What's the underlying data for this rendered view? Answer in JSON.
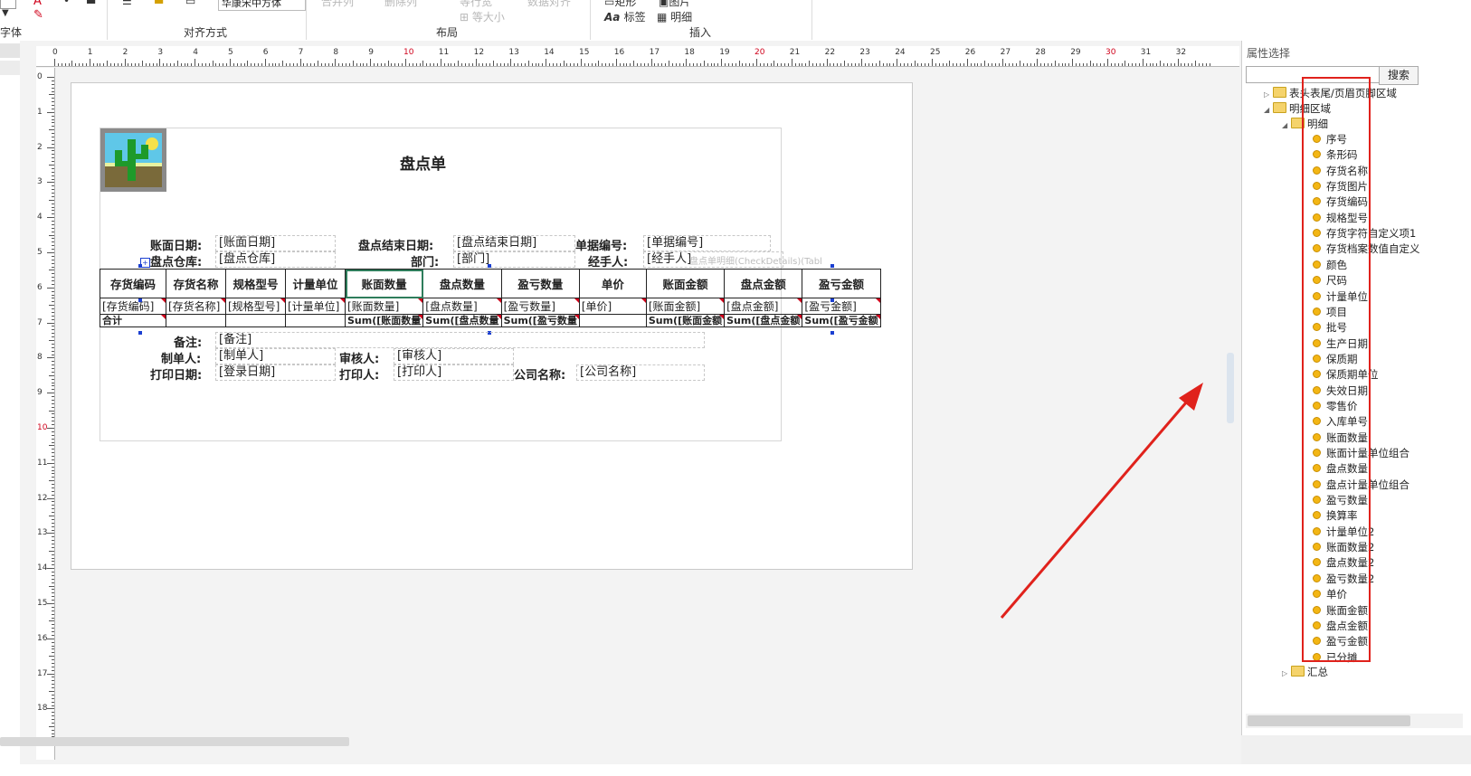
{
  "ribbon": {
    "font_group": "字体",
    "align_group": "对齐方式",
    "layout_group": "布局",
    "insert_group": "插入",
    "font_select": "华康宋中方体",
    "layout_top_items": [
      "合并列",
      "删除列",
      "等行宽",
      "数据对齐"
    ],
    "same_size": "等大小",
    "insert_shape": "矩形",
    "insert_image": "图片",
    "insert_label": "标签",
    "insert_detail": "明细"
  },
  "ruler": {
    "h_labels": [
      "0",
      "1",
      "2",
      "3",
      "4",
      "5",
      "6",
      "7",
      "8",
      "9",
      "10",
      "11",
      "12",
      "13",
      "14",
      "15",
      "16",
      "17",
      "18",
      "19",
      "20",
      "21",
      "22",
      "23",
      "24",
      "25",
      "26",
      "27",
      "28",
      "29",
      "30",
      "31",
      "32"
    ],
    "v_labels": [
      "0",
      "1",
      "2",
      "3",
      "4",
      "5",
      "6",
      "7",
      "8",
      "9",
      "10",
      "11",
      "12",
      "13",
      "14",
      "15",
      "16",
      "17",
      "18"
    ]
  },
  "report": {
    "title": "盘点单",
    "header": {
      "book_date_label": "账面日期:",
      "book_date_value": "[账面日期]",
      "end_date_label": "盘点结束日期:",
      "end_date_value": "[盘点结束日期]",
      "doc_no_label": "单据编号:",
      "doc_no_value": "[单据编号]",
      "warehouse_label": "盘点仓库:",
      "warehouse_value": "[盘点仓库]",
      "dept_label": "部门:",
      "dept_value": "[部门]",
      "handler_label": "经手人:",
      "handler_value": "[经手人]",
      "detail_ghost": "盘点单明细(CheckDetails)(Tabl"
    },
    "columns": [
      "存货编码",
      "存货名称",
      "规格型号",
      "计量单位",
      "账面数量",
      "盘点数量",
      "盈亏数量",
      "单价",
      "账面金额",
      "盘点金额",
      "盈亏金额"
    ],
    "detail_row": [
      "[存货编码]",
      "[存货名称]",
      "[规格型号]",
      "[计量单位]",
      "[账面数量]",
      "[盘点数量]",
      "[盈亏数量]",
      "[单价]",
      "[账面金额]",
      "[盘点金额]",
      "[盈亏金额]"
    ],
    "total_row": [
      "合计",
      "",
      "",
      "",
      "Sum([账面数量",
      "Sum([盘点数量",
      "Sum([盈亏数量",
      "",
      "Sum([账面金额",
      "Sum([盘点金额",
      "Sum([盈亏金额"
    ],
    "footer": {
      "remark_label": "备注:",
      "remark_value": "[备注]",
      "maker_label": "制单人:",
      "maker_value": "[制单人]",
      "reviewer_label": "审核人:",
      "reviewer_value": "[审核人]",
      "print_date_label": "打印日期:",
      "print_date_value": "[登录日期]",
      "printer_label": "打印人:",
      "printer_value": "[打印人]",
      "company_label": "公司名称:",
      "company_value": "[公司名称]"
    }
  },
  "properties": {
    "title": "属性选择",
    "search_placeholder": "",
    "search_button": "搜索",
    "tree": {
      "header_footer": "表头表尾/页眉页脚区域",
      "detail_area": "明细区域",
      "detail": "明细",
      "fields": [
        "序号",
        "条形码",
        "存货名称",
        "存货图片",
        "存货编码",
        "规格型号",
        "存货字符自定义项1",
        "存货档案数值自定义",
        "颜色",
        "尺码",
        "计量单位",
        "项目",
        "批号",
        "生产日期",
        "保质期",
        "保质期单位",
        "失效日期",
        "零售价",
        "入库单号",
        "账面数量",
        "账面计量单位组合",
        "盘点数量",
        "盘点计量单位组合",
        "盈亏数量",
        "换算率",
        "计量单位2",
        "账面数量2",
        "盘点数量2",
        "盈亏数量2",
        "单价",
        "账面金额",
        "盘点金额",
        "盈亏金额",
        "已分摊"
      ],
      "summary": "汇总"
    }
  },
  "colors": {
    "highlight": "#e0221c",
    "selection_handle": "#1b3fd1",
    "folder": "#f5d36b",
    "field_dot": "#f3b614"
  }
}
